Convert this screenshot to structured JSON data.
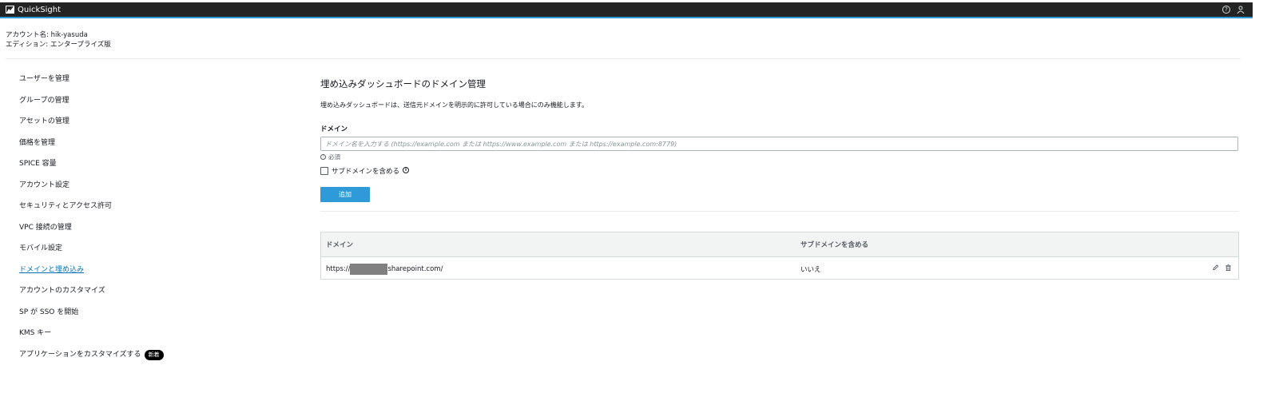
{
  "app": {
    "title": "QuickSight"
  },
  "account": {
    "name_line": "アカウント名: hik-yasuda",
    "edition_line": "エディション: エンタープライズ版"
  },
  "sidebar": {
    "items": [
      {
        "label": "ユーザーを管理"
      },
      {
        "label": "グループの管理"
      },
      {
        "label": "アセットの管理"
      },
      {
        "label": "価格を管理"
      },
      {
        "label": "SPICE 容量"
      },
      {
        "label": "アカウント設定"
      },
      {
        "label": "セキュリティとアクセス許可"
      },
      {
        "label": "VPC 接続の管理"
      },
      {
        "label": "モバイル設定"
      },
      {
        "label": "ドメインと埋め込み",
        "active": true
      },
      {
        "label": "アカウントのカスタマイズ"
      },
      {
        "label": "SP が SSO を開始"
      },
      {
        "label": "KMS キー"
      },
      {
        "label": "アプリケーションをカスタマイズする",
        "badge": "新着"
      }
    ]
  },
  "main": {
    "title": "埋め込みダッシュボードのドメイン管理",
    "description": "埋め込みダッシュボードは、送信元ドメインを明示的に許可している場合にのみ機能します。",
    "field_label": "ドメイン",
    "input_placeholder": "ドメイン名を入力する (https://example.com または https://www.example.com または https://example.com:8779)",
    "required_text": "必須",
    "checkbox_label": "サブドメインを含める",
    "add_button": "追加"
  },
  "table": {
    "headers": [
      "ドメイン",
      "サブドメインを含める"
    ],
    "rows": [
      {
        "domain_prefix": "https://",
        "domain_suffix": "sharepoint.com/",
        "include_subdomains": "いいえ"
      }
    ]
  },
  "icons": [
    "quicksight-logo-icon",
    "help-icon",
    "user-icon",
    "info-icon",
    "edit-icon",
    "delete-icon"
  ],
  "colors": {
    "topbar": "#232323",
    "accent": "#2e9bd8",
    "link": "#0073bb"
  }
}
